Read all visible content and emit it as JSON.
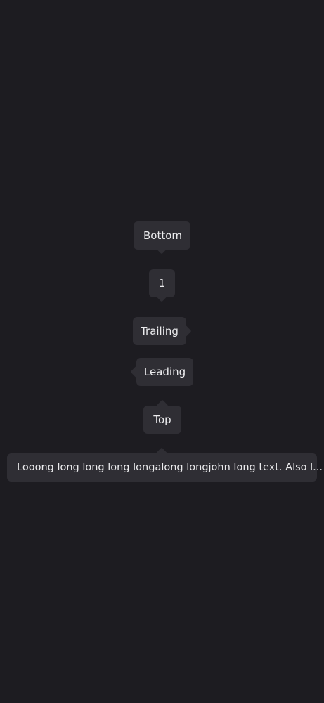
{
  "tooltips": {
    "bottom": "Bottom",
    "number": "1",
    "trailing": "Trailing",
    "leading": "Leading",
    "top": "Top",
    "long": "Looong long long long longalong longjohn long text. Also l..."
  },
  "colors": {
    "background": "#1d1c21",
    "tooltip": "#2f2e34",
    "text": "#ececee"
  }
}
